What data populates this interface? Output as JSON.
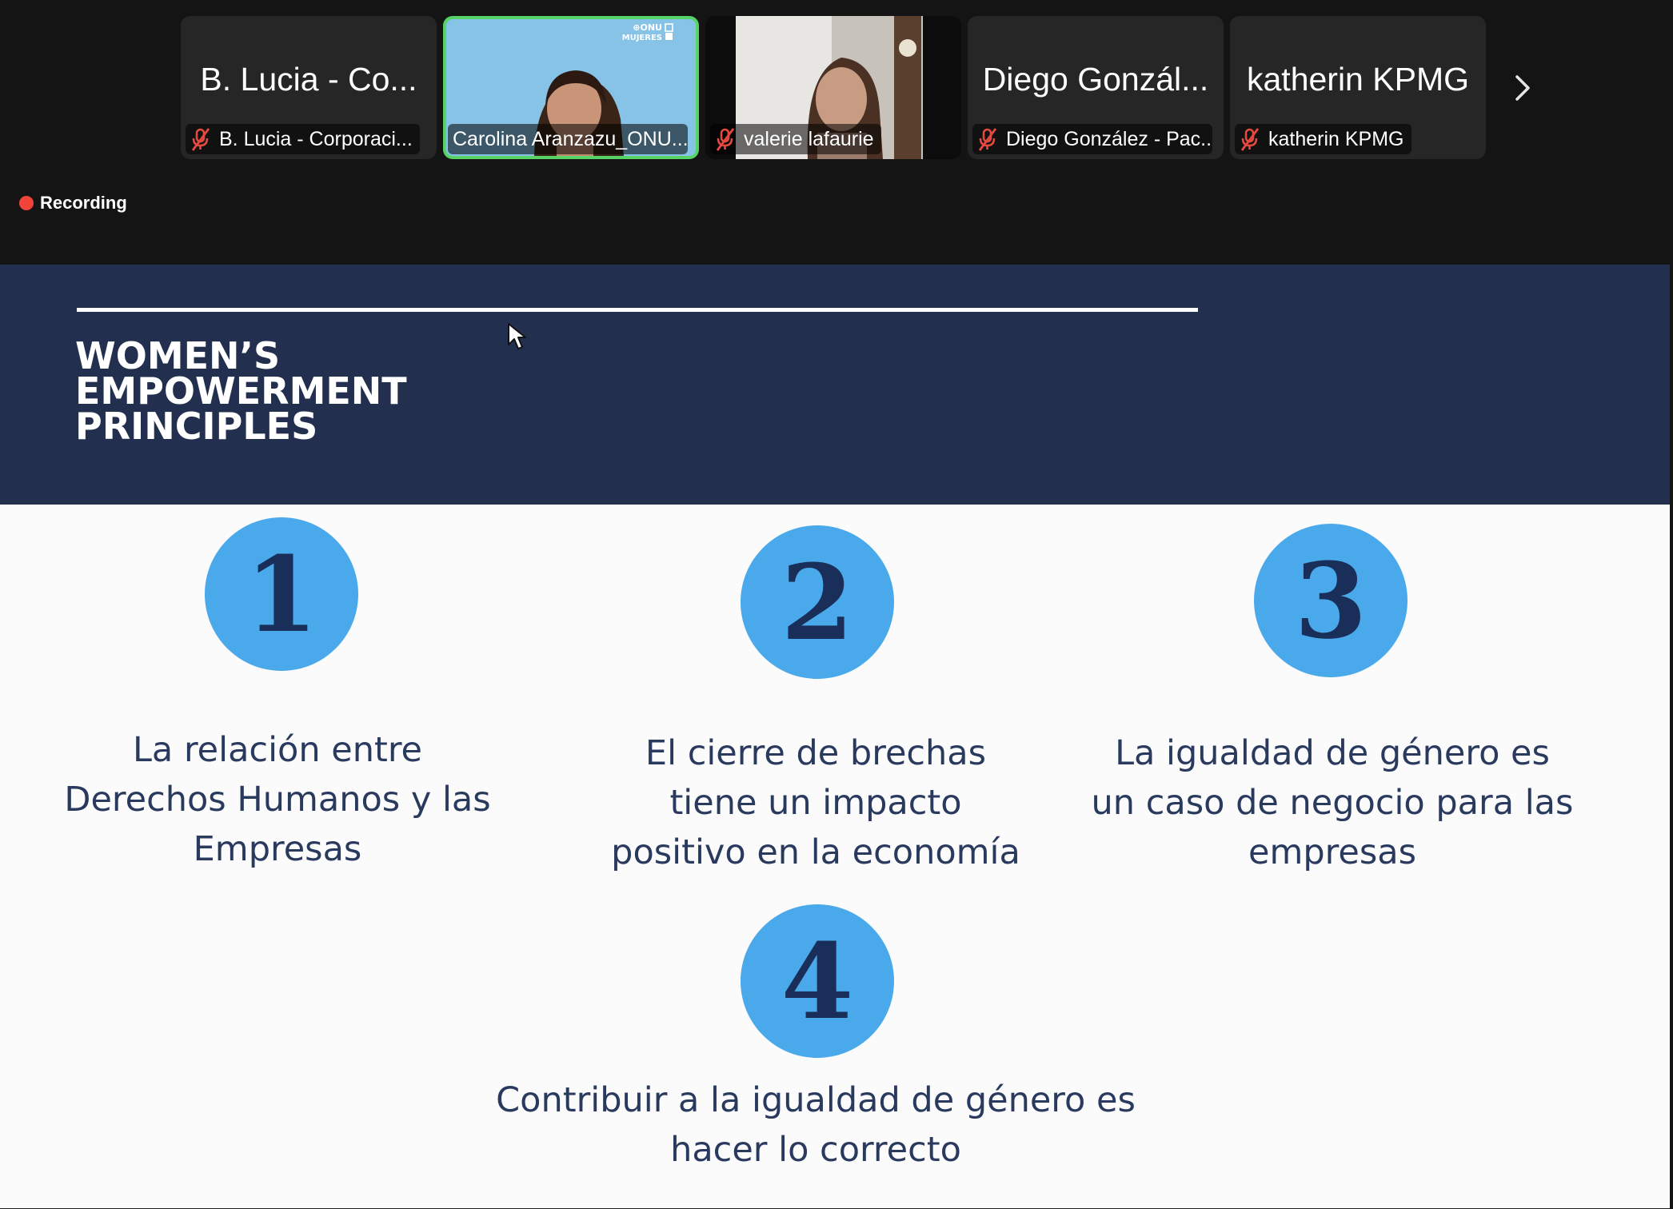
{
  "gallery": {
    "participants": [
      {
        "display_name": "B. Lucia  - Co...",
        "label": "B. Lucia  - Corporaci...",
        "muted": true,
        "video": false
      },
      {
        "display_name": "",
        "label": "Carolina Aranzazu_ONU...",
        "muted": false,
        "video": true,
        "active_speaker": true
      },
      {
        "display_name": "",
        "label": "valerie lafaurie",
        "muted": true,
        "video": true
      },
      {
        "display_name": "Diego Gonzál...",
        "label": "Diego González - Pac...",
        "muted": true,
        "video": false
      },
      {
        "display_name": "katherin KPMG",
        "label": "katherin KPMG",
        "muted": true,
        "video": false
      }
    ],
    "next_icon": "chevron-right-icon",
    "video_overlay_text": "ONU MUJERES"
  },
  "recording": {
    "label": "Recording",
    "color": "#f0443a"
  },
  "slide": {
    "title_lines": [
      "WOMEN’S",
      "EMPOWERMENT",
      "PRINCIPLES"
    ],
    "header_color": "#232f4e",
    "circle_color": "#4aa9ea",
    "principles": [
      {
        "number": "1",
        "lines": [
          "La relación entre",
          "Derechos Humanos y las",
          "Empresas"
        ]
      },
      {
        "number": "2",
        "lines": [
          "El cierre de brechas",
          "tiene un impacto",
          "positivo en la economía"
        ]
      },
      {
        "number": "3",
        "lines": [
          "La igualdad de género es",
          "un caso de negocio para las",
          "empresas"
        ]
      },
      {
        "number": "4",
        "lines": [
          "Contribuir a la igualdad de género es",
          "hacer lo correcto"
        ]
      }
    ]
  },
  "colors": {
    "active_speaker_border": "#56d364",
    "background": "#141414"
  }
}
